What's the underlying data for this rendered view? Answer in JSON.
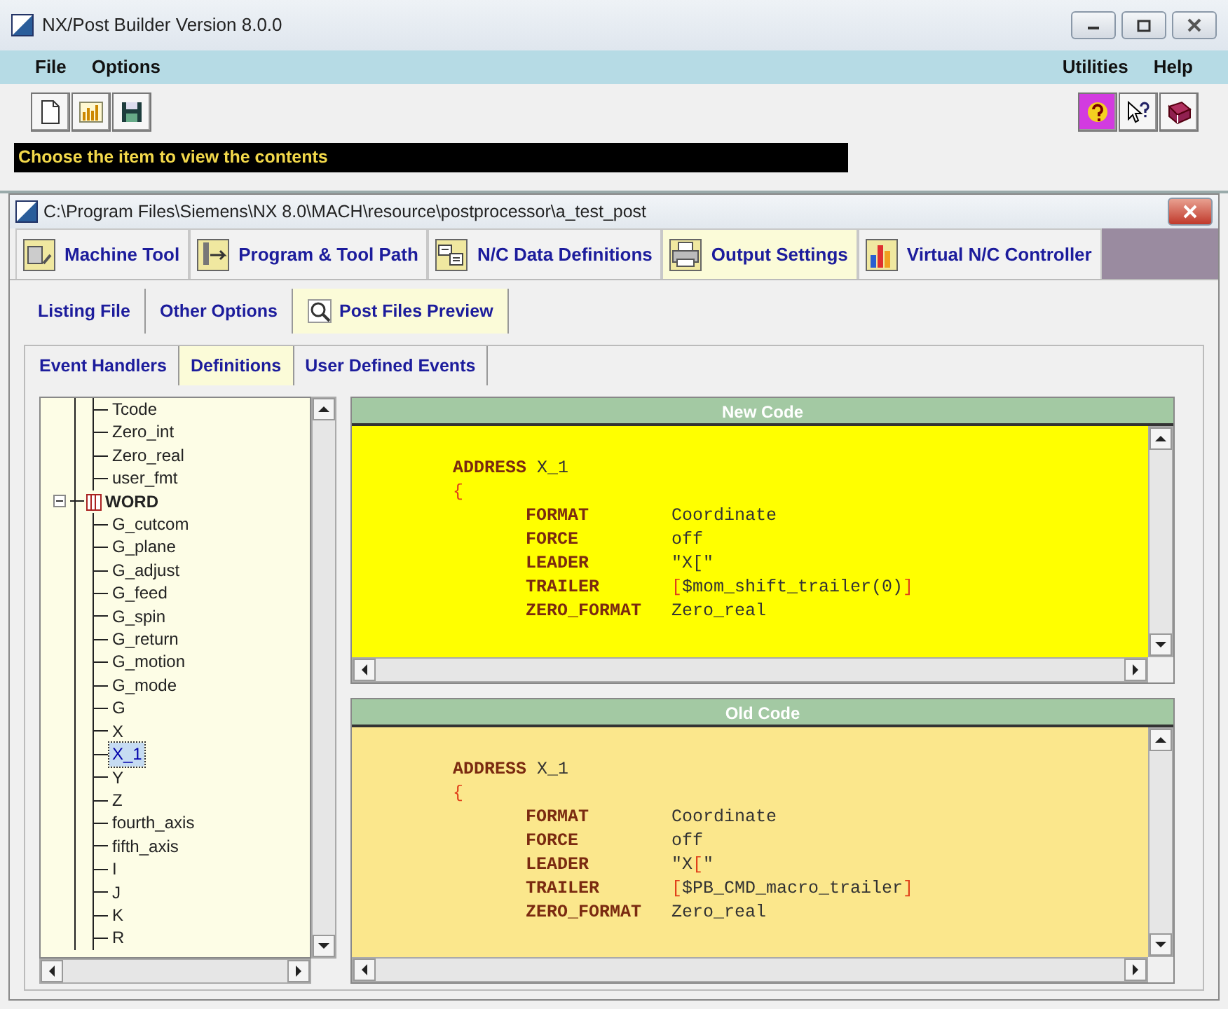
{
  "window": {
    "title": "NX/Post Builder Version 8.0.0"
  },
  "menu": {
    "left": [
      "File",
      "Options"
    ],
    "right": [
      "Utilities",
      "Help"
    ]
  },
  "toolbar": {
    "left": [
      {
        "kind": "new"
      },
      {
        "kind": "open"
      },
      {
        "kind": "save"
      }
    ],
    "right": [
      {
        "kind": "help",
        "selected": true
      },
      {
        "kind": "whatsthis",
        "selected": false
      },
      {
        "kind": "manual",
        "selected": false
      }
    ]
  },
  "status_bar": "Choose the item to view the contents",
  "project": {
    "title": "C:\\Program Files\\Siemens\\NX 8.0\\MACH\\resource\\postprocessor\\a_test_post",
    "tabs": [
      {
        "label": "Machine Tool",
        "kind": "machine",
        "selected": false
      },
      {
        "label": "Program & Tool Path",
        "kind": "path",
        "selected": false
      },
      {
        "label": "N/C Data Definitions",
        "kind": "data",
        "selected": false
      },
      {
        "label": "Output Settings",
        "kind": "output",
        "selected": true
      },
      {
        "label": "Virtual N/C Controller",
        "kind": "controller",
        "selected": false
      }
    ],
    "subtabs": [
      {
        "label": "Listing File",
        "selected": false
      },
      {
        "label": "Other Options",
        "selected": false
      },
      {
        "label": "Post Files Preview",
        "selected": true
      }
    ],
    "subsubtabs": [
      {
        "label": "Event Handlers",
        "selected": false
      },
      {
        "label": "Definitions",
        "selected": true
      },
      {
        "label": "User Defined Events",
        "selected": false
      }
    ],
    "tree": [
      {
        "children": [
          {
            "label": "Tcode",
            "selected": false
          },
          {
            "label": "Zero_int",
            "selected": false
          },
          {
            "label": "Zero_real",
            "selected": false
          },
          {
            "label": "user_fmt",
            "selected": false
          }
        ]
      },
      {
        "label": "WORD",
        "selected": false,
        "expanded": true,
        "children": [
          {
            "label": "G_cutcom",
            "selected": false
          },
          {
            "label": "G_plane",
            "selected": false
          },
          {
            "label": "G_adjust",
            "selected": false
          },
          {
            "label": "G_feed",
            "selected": false
          },
          {
            "label": "G_spin",
            "selected": false
          },
          {
            "label": "G_return",
            "selected": false
          },
          {
            "label": "G_motion",
            "selected": false
          },
          {
            "label": "G_mode",
            "selected": false
          },
          {
            "label": "G",
            "selected": false
          },
          {
            "label": "X",
            "selected": false
          },
          {
            "label": "X_1",
            "selected": true
          },
          {
            "label": "Y",
            "selected": false
          },
          {
            "label": "Z",
            "selected": false
          },
          {
            "label": "fourth_axis",
            "selected": false
          },
          {
            "label": "fifth_axis",
            "selected": false
          },
          {
            "label": "I",
            "selected": false
          },
          {
            "label": "J",
            "selected": false
          },
          {
            "label": "K",
            "selected": false
          },
          {
            "label": "R",
            "selected": false
          }
        ]
      }
    ],
    "panes": [
      {
        "title": "New Code",
        "color": "#ffff00",
        "lines": [
          {
            "kind": "header",
            "key": "ADDRESS",
            "value": "X_1"
          },
          {
            "kind": "brace",
            "value": "{"
          },
          {
            "kind": "entry",
            "key": "FORMAT",
            "parts": [
              {
                "text": "Coordinate",
                "kind": "plain"
              }
            ]
          },
          {
            "kind": "entry",
            "key": "FORCE",
            "parts": [
              {
                "text": "off",
                "kind": "plain"
              }
            ]
          },
          {
            "kind": "entry",
            "key": "LEADER",
            "parts": [
              {
                "text": "\"X[\"",
                "kind": "plain"
              }
            ]
          },
          {
            "kind": "entry",
            "key": "TRAILER",
            "parts": [
              {
                "text": "[",
                "kind": "punct"
              },
              {
                "text": "$mom_shift_trailer(0)",
                "kind": "plain"
              },
              {
                "text": "]",
                "kind": "punct"
              }
            ]
          },
          {
            "kind": "entry",
            "key": "ZERO_FORMAT",
            "parts": [
              {
                "text": "Zero_real",
                "kind": "plain"
              }
            ]
          }
        ]
      },
      {
        "title": "Old Code",
        "color": "#fbe78c",
        "lines": [
          {
            "kind": "header",
            "key": "ADDRESS",
            "value": "X_1"
          },
          {
            "kind": "brace",
            "value": "{"
          },
          {
            "kind": "entry",
            "key": "FORMAT",
            "parts": [
              {
                "text": "Coordinate",
                "kind": "plain"
              }
            ]
          },
          {
            "kind": "entry",
            "key": "FORCE",
            "parts": [
              {
                "text": "off",
                "kind": "plain"
              }
            ]
          },
          {
            "kind": "entry",
            "key": "LEADER",
            "parts": [
              {
                "text": "\"X",
                "kind": "plain"
              },
              {
                "text": "[",
                "kind": "punct"
              },
              {
                "text": "\"",
                "kind": "plain"
              }
            ]
          },
          {
            "kind": "entry",
            "key": "TRAILER",
            "parts": [
              {
                "text": "[",
                "kind": "punct"
              },
              {
                "text": "$PB_CMD_macro_trailer",
                "kind": "plain"
              },
              {
                "text": "]",
                "kind": "punct"
              }
            ]
          },
          {
            "kind": "entry",
            "key": "ZERO_FORMAT",
            "parts": [
              {
                "text": "Zero_real",
                "kind": "plain"
              }
            ]
          }
        ]
      }
    ]
  }
}
